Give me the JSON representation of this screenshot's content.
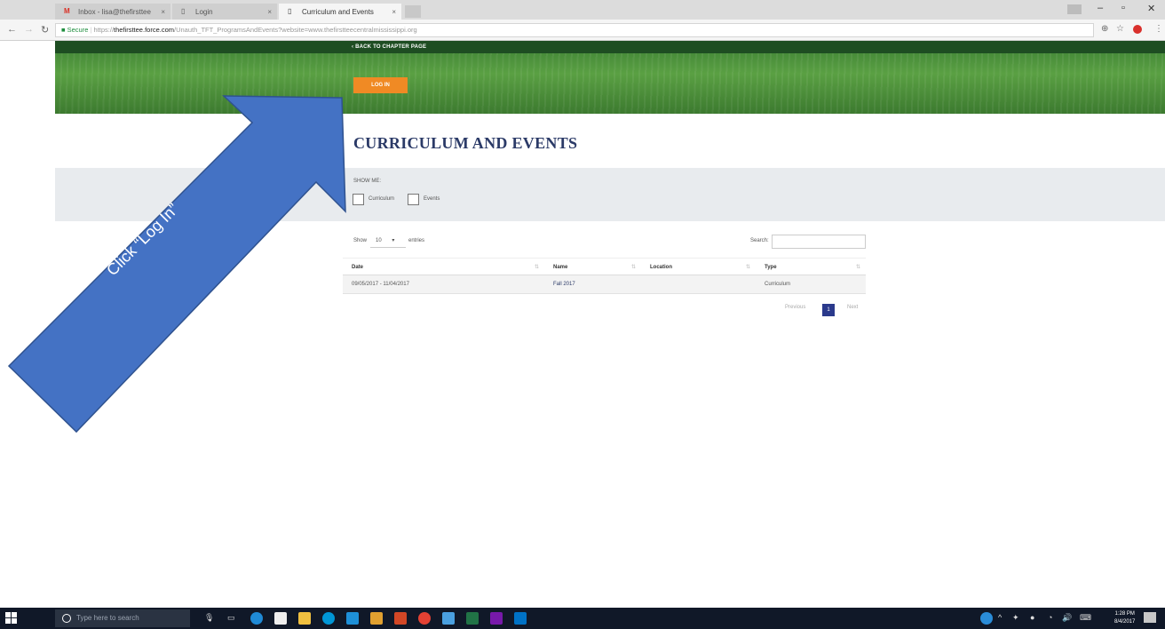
{
  "browser": {
    "tabs": [
      {
        "title": "Inbox - lisa@thefirsttee",
        "icon": "gmail-icon"
      },
      {
        "title": "Login",
        "icon": "page-icon"
      },
      {
        "title": "Curriculum and Events",
        "icon": "page-icon"
      }
    ],
    "tab_close": "×",
    "url_secure": "Secure",
    "url_prefix": "https://",
    "url_host": "thefirsttee.force.com",
    "url_path": "/Unauth_TFT_ProgramsAndEvents?website=www.thefirstteecentralmississippi.org"
  },
  "page": {
    "back_link": "‹  BACK TO CHAPTER PAGE",
    "login_button": "LOG IN",
    "title": "CURRICULUM AND EVENTS",
    "filter": {
      "show_me": "SHOW ME:",
      "options": [
        "Curriculum",
        "Events"
      ]
    },
    "table_controls": {
      "show": "Show",
      "entries_value": "10",
      "entries": "entries",
      "search_label": "Search:"
    },
    "table": {
      "headers": [
        "Date",
        "Name",
        "Location",
        "Type"
      ],
      "rows": [
        {
          "date": "09/05/2017 - 11/04/2017",
          "name": "Fall 2017",
          "location": "",
          "type": "Curriculum"
        }
      ]
    },
    "pagination": {
      "previous": "Previous",
      "current": "1",
      "next": "Next"
    }
  },
  "annotation": {
    "text": "Click “Log In”",
    "color": "#4472C4"
  },
  "taskbar": {
    "search_placeholder": "Type here to search",
    "time": "1:28 PM",
    "date": "8/4/2017"
  }
}
